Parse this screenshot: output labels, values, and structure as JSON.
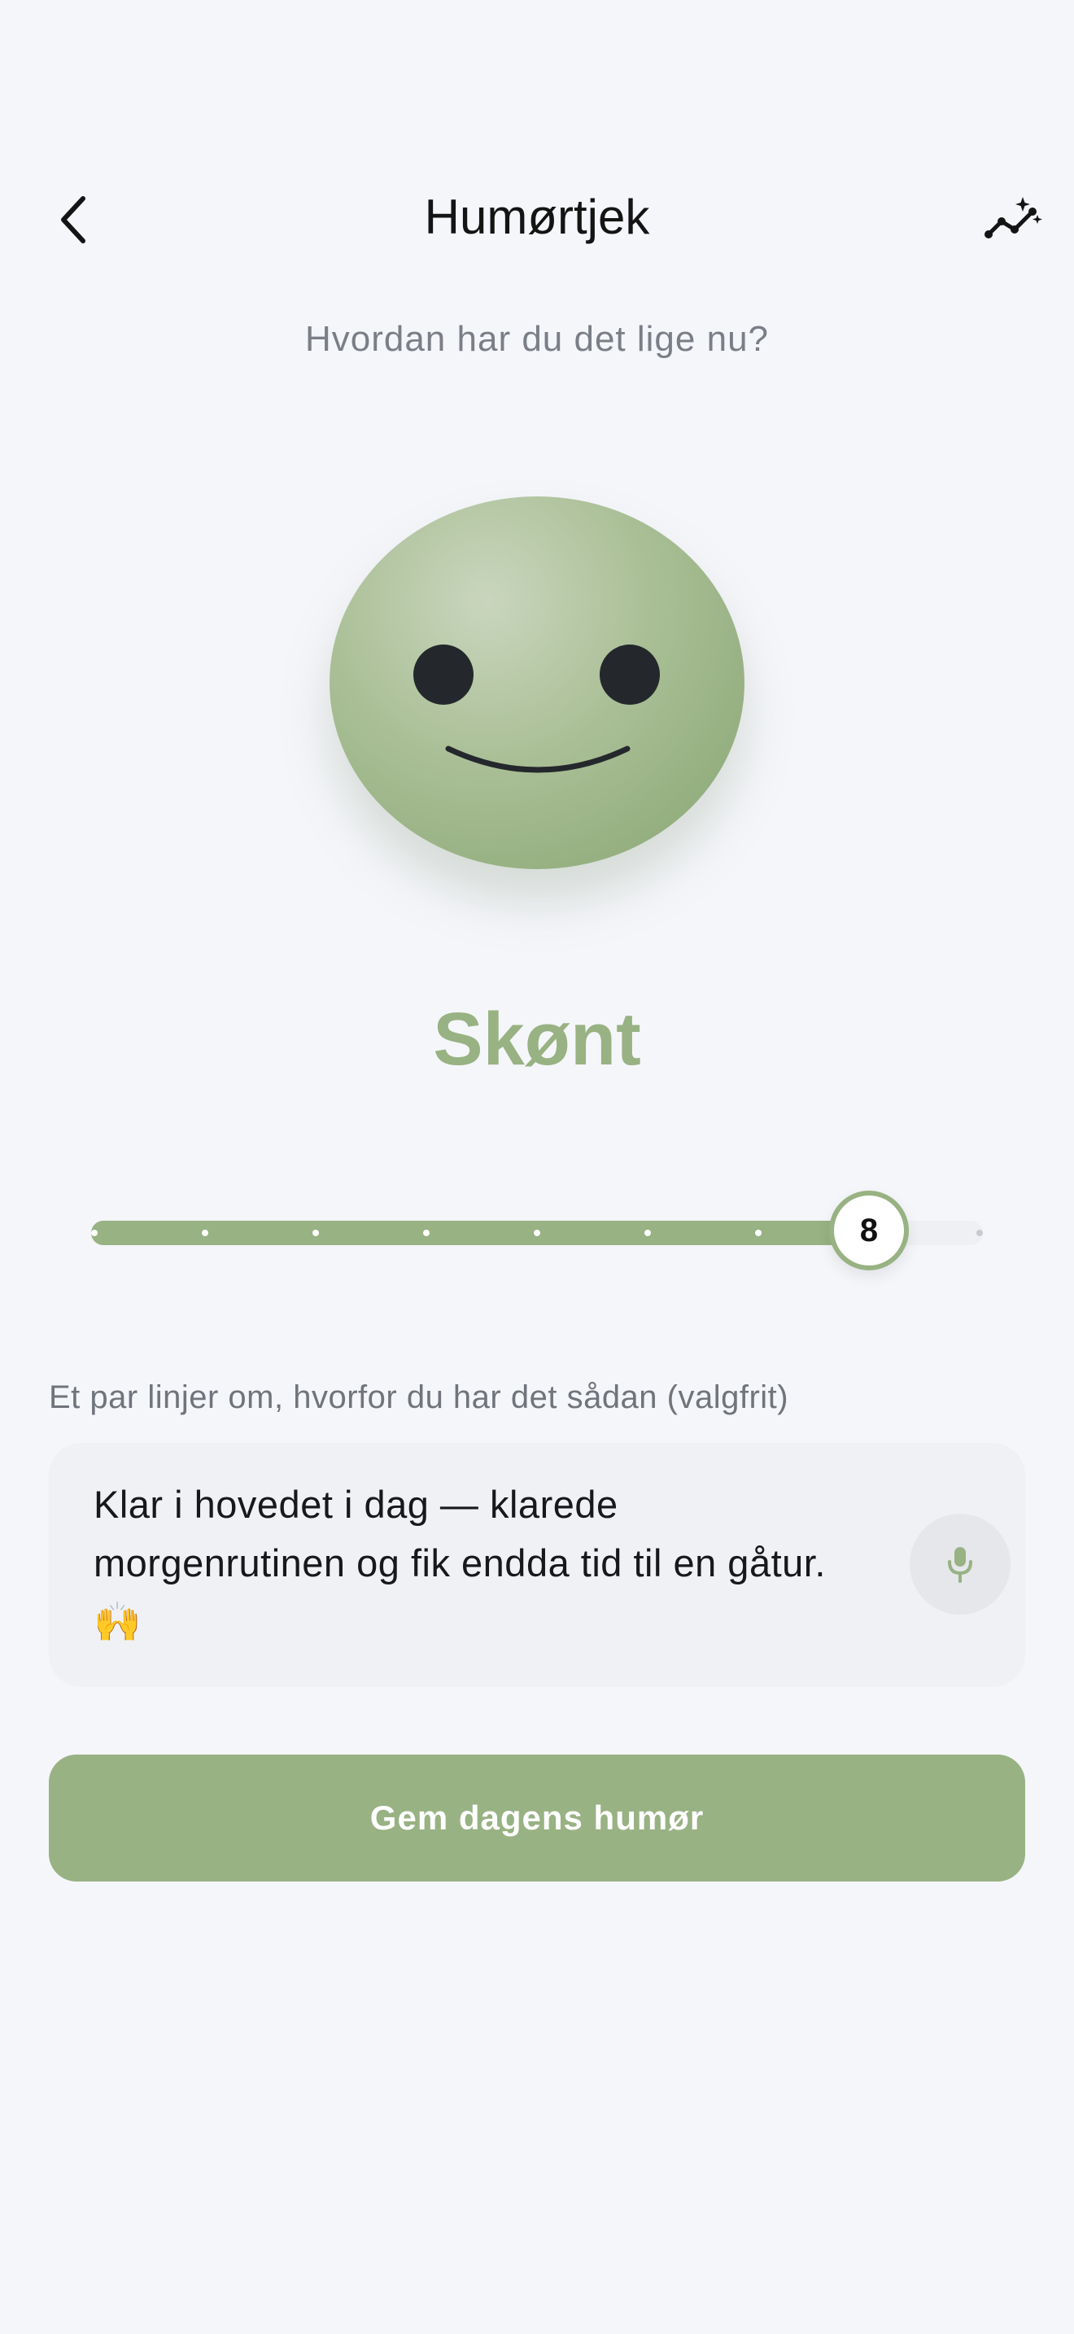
{
  "header": {
    "title": "Humørtjek",
    "back_icon": "chevron-left-icon",
    "insights_icon": "sparkle-trend-icon"
  },
  "prompt": "Hvordan har du det lige nu?",
  "mood": {
    "label": "Skønt",
    "value": 8,
    "min": 1,
    "max": 9,
    "face_icon": "smiley-face-icon",
    "accent_color": "#98B283"
  },
  "note": {
    "label": "Et par linjer om, hvorfor du har det sådan (valgfrit)",
    "value": "Klar i hovedet i dag — klarede morgenrutinen og fik endda tid til en gåtur. 🙌",
    "mic_icon": "microphone-icon"
  },
  "actions": {
    "save_label": "Gem dagens humør"
  }
}
